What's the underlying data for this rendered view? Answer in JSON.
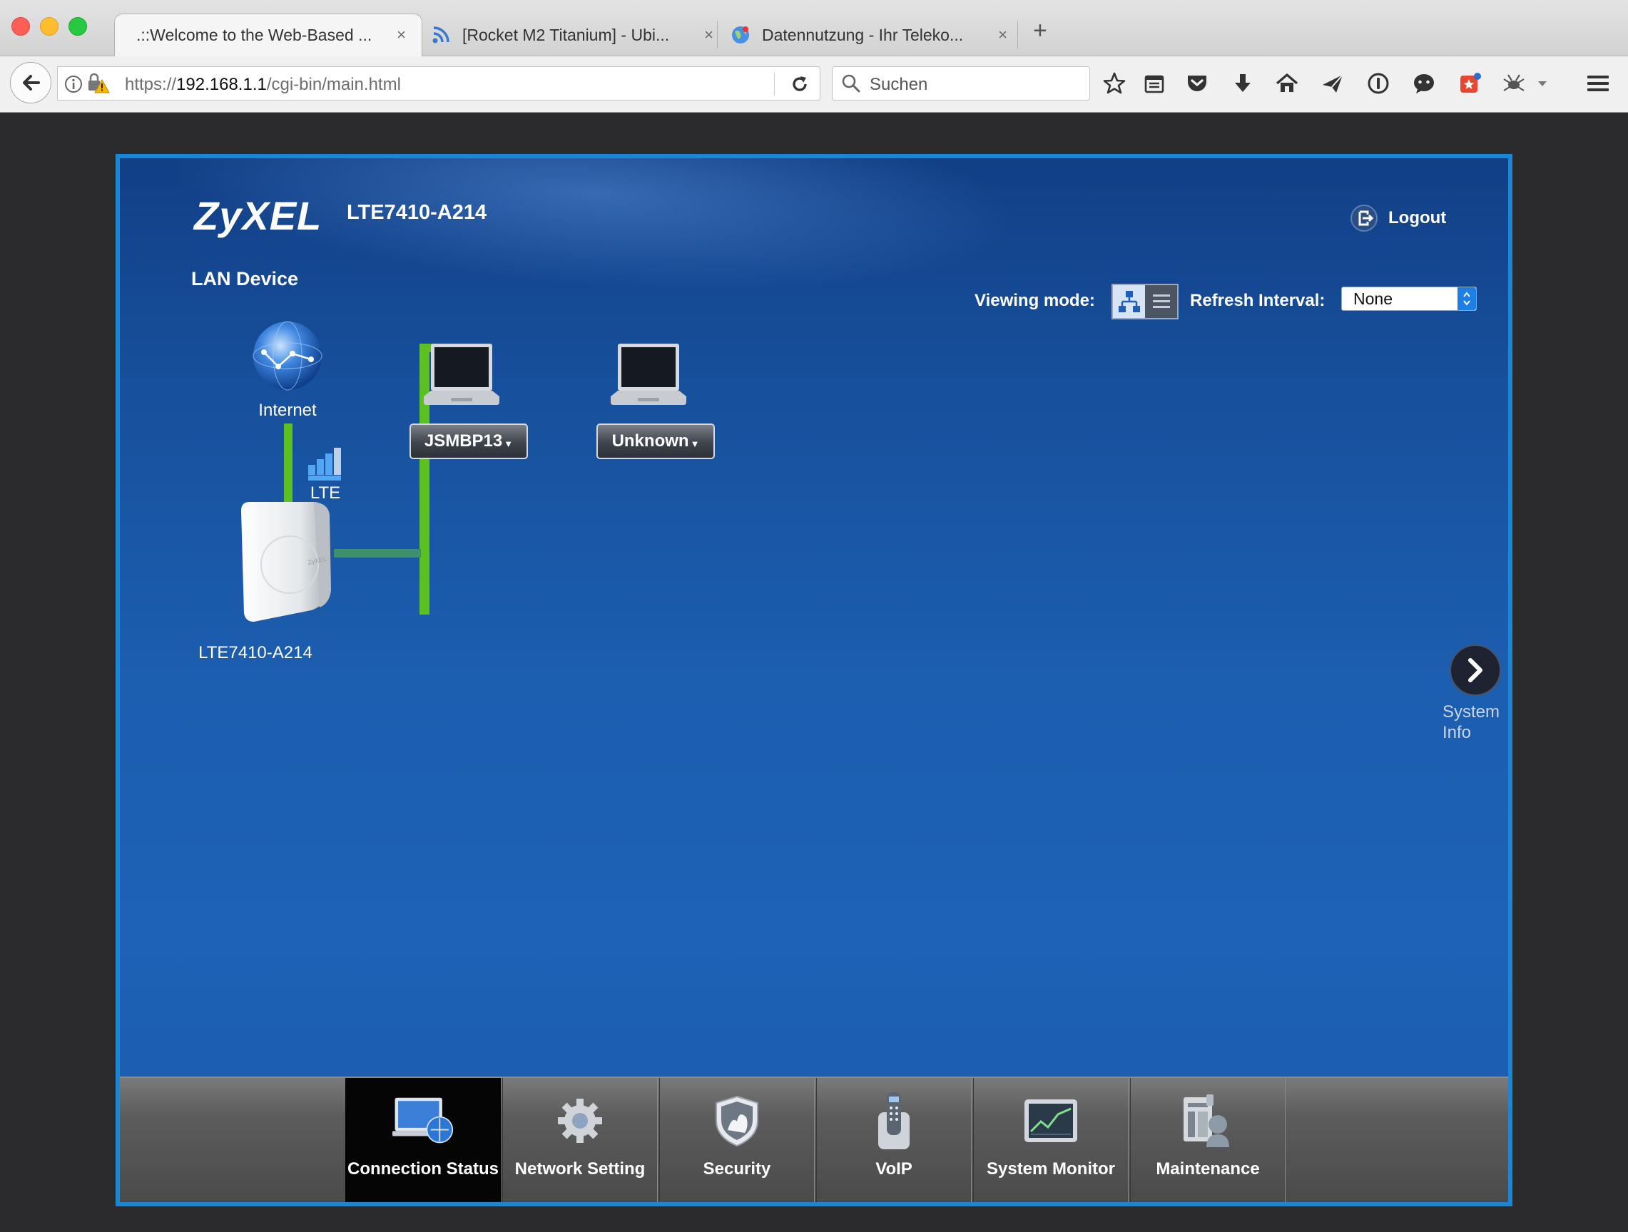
{
  "browser": {
    "tabs": [
      {
        "title": ".::Welcome to the Web-Based ...",
        "favicon": "none"
      },
      {
        "title": "[Rocket M2 Titanium] - Ubi...",
        "favicon": "rss-icon"
      },
      {
        "title": "Datennutzung - Ihr Teleko...",
        "favicon": "globe-icon"
      }
    ],
    "close_glyph": "×",
    "new_tab_glyph": "+",
    "url_prefix": "https://",
    "url_host": "192.168.1.1",
    "url_path": "/cgi-bin/main.html",
    "search_placeholder": "Suchen"
  },
  "router": {
    "brand": "ZyXEL",
    "model": "LTE7410-A214",
    "logout_label": "Logout",
    "section_title": "LAN Device",
    "viewing_mode_label": "Viewing mode:",
    "refresh_label": "Refresh Interval:",
    "refresh_value": "None",
    "topology": {
      "internet_label": "Internet",
      "lte_label": "LTE",
      "router_label": "LTE7410-A214",
      "devices": [
        {
          "name": "JSMBP13",
          "icon": "laptop-icon"
        },
        {
          "name": "Unknown",
          "icon": "laptop-icon"
        }
      ],
      "link_color": "#5cc021"
    },
    "system_info": {
      "line1": "System",
      "line2": "Info"
    },
    "menu": [
      {
        "label": "Connection Status",
        "icon": "connection-status-icon",
        "active": true
      },
      {
        "label": "Network Setting",
        "icon": "gear-icon",
        "active": false
      },
      {
        "label": "Security",
        "icon": "shield-icon",
        "active": false
      },
      {
        "label": "VoIP",
        "icon": "phone-icon",
        "active": false
      },
      {
        "label": "System Monitor",
        "icon": "monitor-chart-icon",
        "active": false
      },
      {
        "label": "Maintenance",
        "icon": "maintenance-icon",
        "active": false
      }
    ],
    "colors": {
      "frame_border": "#1a86d6",
      "background": "#1d62b7",
      "active_menu": "#050505"
    }
  }
}
